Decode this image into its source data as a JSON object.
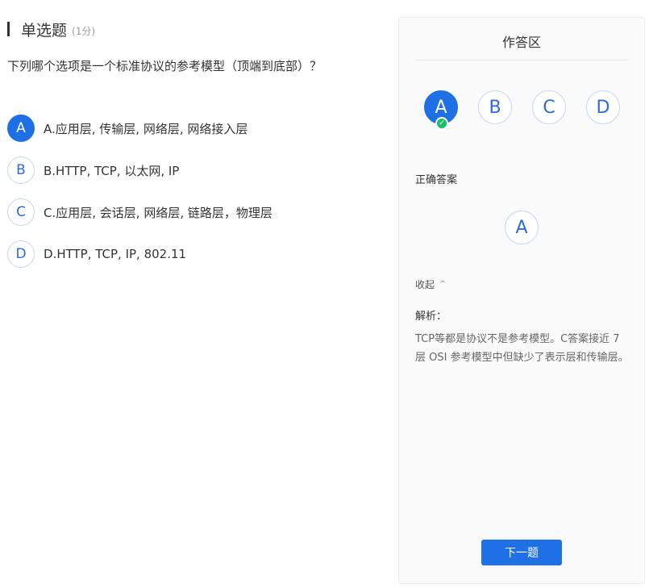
{
  "question": {
    "type_label": "单选题",
    "score_label": "(1分)",
    "text": "下列哪个选项是一个标准协议的参考模型（顶端到底部）？",
    "options": [
      {
        "letter": "A",
        "text": "A.应用层, 传输层, 网络层, 网络接入层",
        "selected": true
      },
      {
        "letter": "B",
        "text": "B.HTTP, TCP, 以太网, IP",
        "selected": false
      },
      {
        "letter": "C",
        "text": "C.应用层, 会话层, 网络层, 链路层，物理层",
        "selected": false
      },
      {
        "letter": "D",
        "text": "D.HTTP, TCP, IP, 802.11",
        "selected": false
      }
    ]
  },
  "panel": {
    "title": "作答区",
    "answer_buttons": [
      "A",
      "B",
      "C",
      "D"
    ],
    "selected_answer": "A",
    "correct_label": "正确答案",
    "correct_answer": "A",
    "collapse_label": "收起",
    "analysis_label": "解析：",
    "analysis_text": "TCP等都是协议不是参考模型。C答案接近 7 层 OSI 参考模型中但缺少了表示层和传输层。",
    "next_button": "下一题"
  },
  "colors": {
    "accent": "#1f6fe5",
    "check_green": "#1bbf6a",
    "outline": "#c5d6f5"
  }
}
